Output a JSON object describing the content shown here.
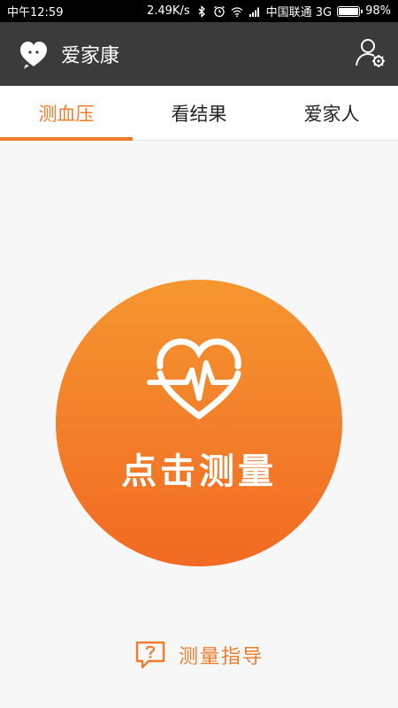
{
  "status_bar": {
    "time": "中午12:59",
    "speed": "2.49K/s",
    "carrier": "中国联通 3G",
    "battery": "98%",
    "battery_level": 0.98,
    "icons": [
      "bluetooth-icon",
      "alarm-icon",
      "wifi-icon",
      "signal-icon",
      "battery-icon"
    ]
  },
  "app_bar": {
    "title": "爱家康",
    "logo_icon": "heart-chat-logo",
    "settings_icon": "user-settings-icon"
  },
  "tabs": [
    {
      "label": "测血压",
      "active": true
    },
    {
      "label": "看结果",
      "active": false
    },
    {
      "label": "爱家人",
      "active": false
    }
  ],
  "main": {
    "measure_button_label": "点击测量",
    "measure_icon": "heart-pulse-icon",
    "guide_label": "测量指导",
    "guide_icon": "question-bubble-icon"
  },
  "colors": {
    "accent": "#f07c2a",
    "app_bar": "#3b3b3b",
    "status_bar": "#000000",
    "background": "#f7f7f7"
  }
}
